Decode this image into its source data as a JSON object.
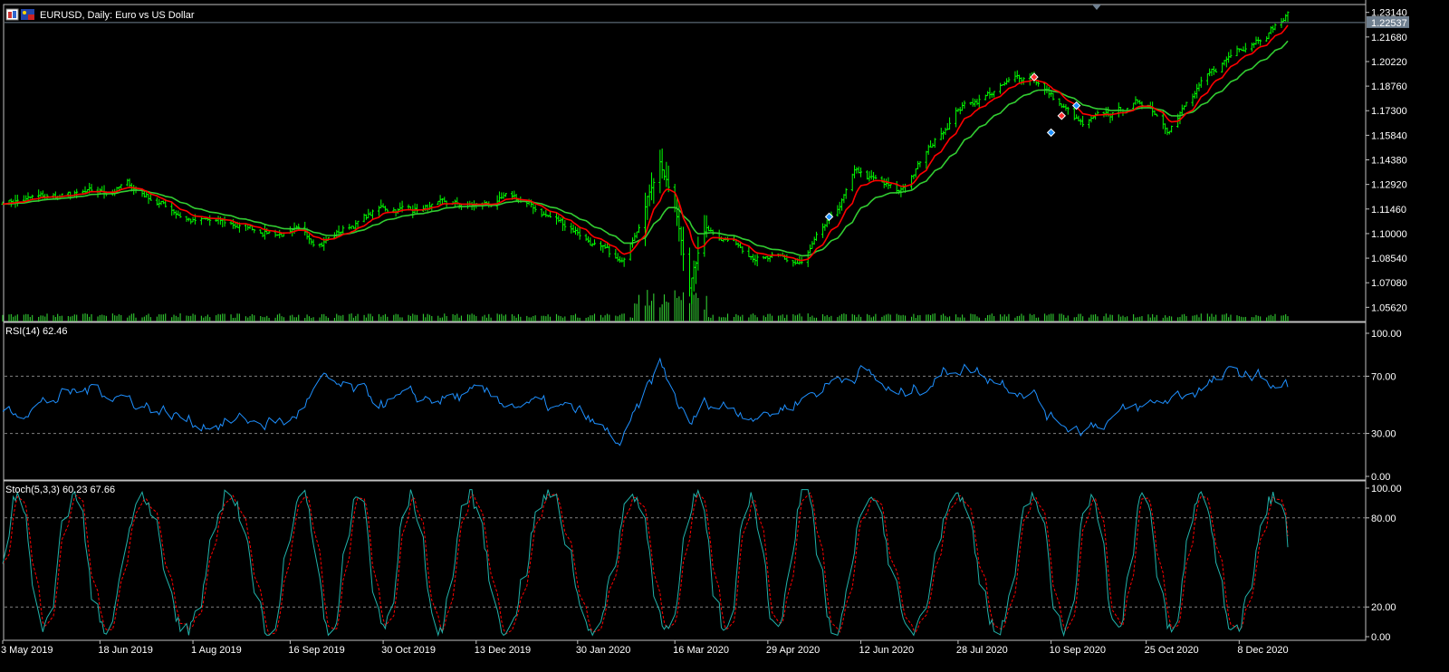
{
  "window": {
    "title": "EURUSD, Daily:  Euro vs US Dollar",
    "symbol_icon": "chart-window-icon",
    "flag_icon": "eur-usd-flag-icon",
    "current_price_label": "1.22537"
  },
  "colors": {
    "background": "#000000",
    "bull_bar": "#00ff00",
    "ma_fast": "#ff0000",
    "ma_slow": "#32cd32",
    "rsi_line": "#1e90ff",
    "stoch_main": "#20b2aa",
    "stoch_signal": "#ff0000",
    "volume": "#32cd32",
    "grid_level": "#808080",
    "price_tag_bg": "#708090",
    "panel_border": "#c0c0c0"
  },
  "chart_data": [
    {
      "type": "candlestick",
      "panel": "price",
      "symbol": "EURUSD",
      "timeframe": "Daily",
      "y_axis_ticks": [
        "1.23140",
        "1.21680",
        "1.20220",
        "1.18760",
        "1.17300",
        "1.15840",
        "1.14380",
        "1.12920",
        "1.11460",
        "1.10000",
        "1.08540",
        "1.07080",
        "1.05620"
      ],
      "ylim": [
        1.051,
        1.235
      ],
      "last_price": 1.22537,
      "close_anchors": [
        [
          "3 May 2019",
          1.1195
        ],
        [
          "18 Jun 2019",
          1.123
        ],
        [
          "1 Jul 2019",
          1.129
        ],
        [
          "1 Aug 2019",
          1.108
        ],
        [
          "16 Sep 2019",
          1.1
        ],
        [
          "1 Oct 2019",
          1.096
        ],
        [
          "30 Oct 2019",
          1.115
        ],
        [
          "13 Dec 2019",
          1.116
        ],
        [
          "31 Dec 2019",
          1.12
        ],
        [
          "30 Jan 2020",
          1.102
        ],
        [
          "20 Feb 2020",
          1.08
        ],
        [
          "9 Mar 2020",
          1.145
        ],
        [
          "16 Mar 2020",
          1.115
        ],
        [
          "23 Mar 2020",
          1.07
        ],
        [
          "31 Mar 2020",
          1.104
        ],
        [
          "29 Apr 2020",
          1.085
        ],
        [
          "15 May 2020",
          1.081
        ],
        [
          "1 Jun 2020",
          1.113
        ],
        [
          "10 Jun 2020",
          1.136
        ],
        [
          "30 Jun 2020",
          1.123
        ],
        [
          "28 Jul 2020",
          1.175
        ],
        [
          "1 Sep 2020",
          1.195
        ],
        [
          "10 Sep 2020",
          1.182
        ],
        [
          "25 Sep 2020",
          1.163
        ],
        [
          "25 Oct 2020",
          1.179
        ],
        [
          "4 Nov 2020",
          1.165
        ],
        [
          "8 Dec 2020",
          1.211
        ],
        [
          "31 Dec 2020",
          1.23
        ]
      ],
      "series": [
        {
          "name": "fast moving average",
          "style": "red line"
        },
        {
          "name": "slow moving average",
          "style": "green line"
        },
        {
          "name": "volume",
          "style": "green histogram"
        }
      ],
      "trade_markers": [
        {
          "date": "28 May 2020",
          "price": 1.11,
          "type": "buy"
        },
        {
          "date": "2 Sep 2020",
          "price": 1.193,
          "type": "sell"
        },
        {
          "date": "10 Sep 2020",
          "price": 1.16,
          "type": "buy"
        },
        {
          "date": "15 Sep 2020",
          "price": 1.17,
          "type": "sell"
        },
        {
          "date": "22 Sep 2020",
          "price": 1.176,
          "type": "buy"
        }
      ]
    },
    {
      "type": "line",
      "panel": "rsi",
      "title": "RSI(14) 62.46",
      "y_axis_ticks": [
        "100.00",
        "70.00",
        "30.00",
        "0.00"
      ],
      "ylim": [
        0,
        100
      ],
      "levels": [
        70,
        30
      ],
      "last_value": 62.46,
      "anchors": [
        [
          "3 May 2019",
          45
        ],
        [
          "18 Jun 2019",
          62
        ],
        [
          "1 Aug 2019",
          38
        ],
        [
          "16 Sep 2019",
          38
        ],
        [
          "1 Oct 2019",
          65
        ],
        [
          "30 Oct 2019",
          52
        ],
        [
          "13 Dec 2019",
          56
        ],
        [
          "30 Jan 2020",
          44
        ],
        [
          "20 Feb 2020",
          22
        ],
        [
          "9 Mar 2020",
          78
        ],
        [
          "23 Mar 2020",
          34
        ],
        [
          "31 Mar 2020",
          52
        ],
        [
          "29 Apr 2020",
          43
        ],
        [
          "1 Jun 2020",
          68
        ],
        [
          "12 Jun 2020",
          75
        ],
        [
          "30 Jun 2020",
          55
        ],
        [
          "28 Jul 2020",
          78
        ],
        [
          "1 Sep 2020",
          60
        ],
        [
          "10 Sep 2020",
          40
        ],
        [
          "25 Sep 2020",
          35
        ],
        [
          "25 Oct 2020",
          48
        ],
        [
          "8 Dec 2020",
          72
        ],
        [
          "31 Dec 2020",
          62.46
        ]
      ]
    },
    {
      "type": "line",
      "panel": "stochastic",
      "title": "Stoch(5,3,3) 60.23 67.66",
      "y_axis_ticks": [
        "100.00",
        "80.00",
        "20.00",
        "0.00"
      ],
      "ylim": [
        0,
        100
      ],
      "levels": [
        80,
        20
      ],
      "series": [
        {
          "name": "main",
          "last_value": 60.23
        },
        {
          "name": "signal",
          "last_value": 67.66
        }
      ]
    }
  ],
  "x_axis_labels": [
    {
      "text": "3 May 2019",
      "date": "3 May 2019"
    },
    {
      "text": "18 Jun 2019",
      "date": "18 Jun 2019"
    },
    {
      "text": "1 Aug 2019",
      "date": "1 Aug 2019"
    },
    {
      "text": "16 Sep 2019",
      "date": "16 Sep 2019"
    },
    {
      "text": "30 Oct 2019",
      "date": "30 Oct 2019"
    },
    {
      "text": "13 Dec 2019",
      "date": "13 Dec 2019"
    },
    {
      "text": "30 Jan 2020",
      "date": "30 Jan 2020"
    },
    {
      "text": "16 Mar 2020",
      "date": "16 Mar 2020"
    },
    {
      "text": "29 Apr 2020",
      "date": "29 Apr 2020"
    },
    {
      "text": "12 Jun 2020",
      "date": "12 Jun 2020"
    },
    {
      "text": "28 Jul 2020",
      "date": "28 Jul 2020"
    },
    {
      "text": "10 Sep 2020",
      "date": "10 Sep 2020"
    },
    {
      "text": "25 Oct 2020",
      "date": "25 Oct 2020"
    },
    {
      "text": "8 Dec 2020",
      "date": "8 Dec 2020"
    }
  ]
}
